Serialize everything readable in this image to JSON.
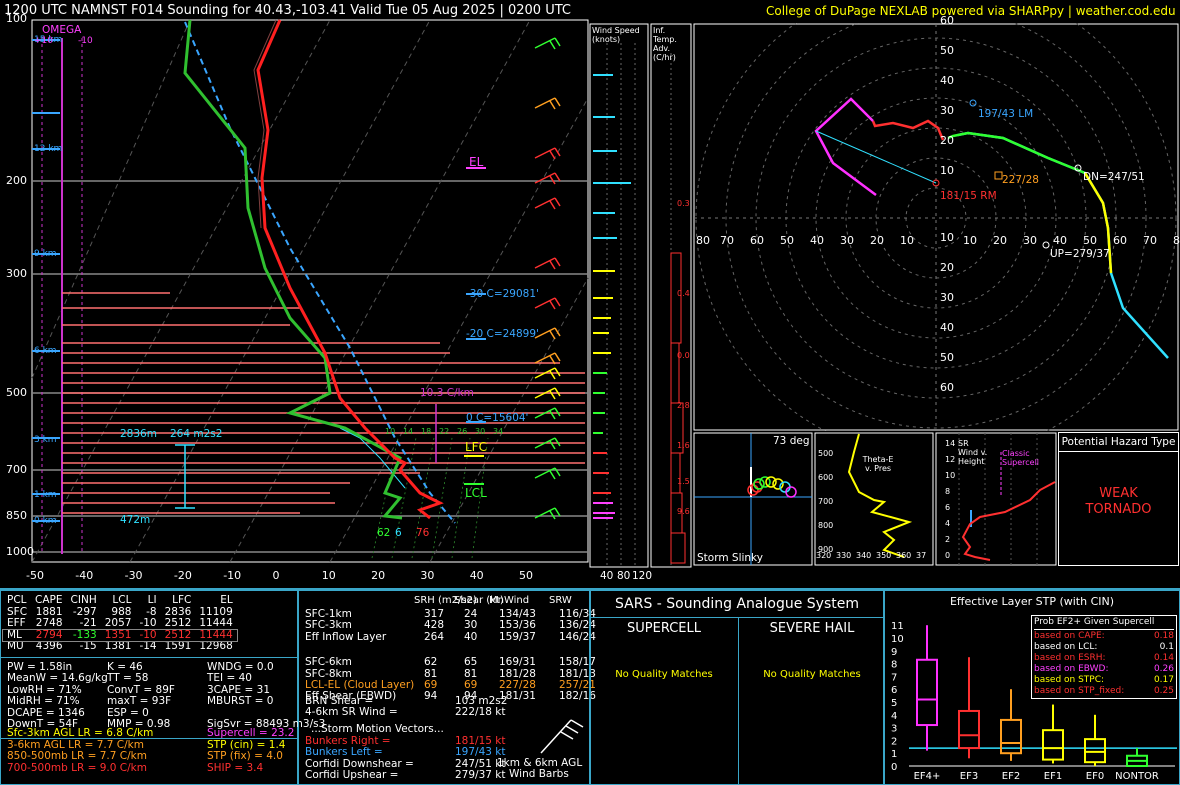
{
  "header": {
    "title": "1200 UTC NAMNST F014 Sounding for 40.43,-103.41 Valid  Tue 05 Aug 2025 | 0200 UTC",
    "credit": "College of DuPage NEXLAB powered via SHARPpy | weather.cod.edu"
  },
  "skewt": {
    "pressure_ticks": [
      "100",
      "200",
      "300",
      "500",
      "700",
      "850",
      "1000"
    ],
    "temp_ticks": [
      "-50",
      "-40",
      "-30",
      "-20",
      "-10",
      "0",
      "10",
      "20",
      "30",
      "40",
      "50"
    ],
    "height_labels": [
      "15 km",
      "12 km",
      "9 km",
      "6 km",
      "3 km",
      "1 km",
      "0 km"
    ],
    "omega_label": "OMEGA",
    "omega_scale": [
      "+10",
      "-10"
    ],
    "labels": {
      "el": "EL",
      "lfc": "LFC",
      "lcl": "LCL",
      "m30": "-30 C=29081'",
      "m20": "-20 C=24899'",
      "zero": "0 C=15604'",
      "lapse": "10.3 C/km",
      "depth": "2836m",
      "srh": "264 m2s2",
      "sfc_depth": "472m",
      "sfc_td": "62",
      "sfc_wb": "6",
      "sfc_t": "76"
    },
    "mix_ratio_labels": [
      "10",
      "14",
      "18",
      "22",
      "26",
      "30",
      "34"
    ]
  },
  "wind_speed": {
    "title": "Wind Speed (knots)",
    "ticks": [
      "40",
      "80",
      "120"
    ]
  },
  "temp_adv": {
    "title": "Inf. Temp. Adv. (C/hr)",
    "values": [
      "0.3",
      "0.4",
      "0.0",
      "2.8",
      "1.6",
      "1.5",
      "9.6"
    ]
  },
  "hodograph": {
    "rings": [
      "10",
      "20",
      "30",
      "40",
      "50",
      "60"
    ],
    "x_ticks": [
      "80",
      "70",
      "60",
      "50",
      "40",
      "30",
      "20",
      "10",
      "10",
      "20",
      "30",
      "40",
      "50",
      "60",
      "70",
      "80"
    ],
    "lm": "197/43 LM",
    "rm": "181/15 RM",
    "mean": "227/28",
    "dn": "DN=247/51",
    "up": "UP=279/37"
  },
  "slinky": {
    "deg": "73 deg",
    "title": "Storm Slinky"
  },
  "theta": {
    "title": "Theta-E v. Pres",
    "y_ticks": [
      "500",
      "600",
      "700",
      "800",
      "900"
    ],
    "x_ticks": [
      "320",
      "330",
      "340",
      "350",
      "360",
      "37"
    ]
  },
  "srwind": {
    "title": "SR Wind v. Height",
    "y_ticks": [
      "14",
      "12",
      "10",
      "8",
      "6",
      "4",
      "2",
      "0"
    ],
    "classic": "Classic Supercell"
  },
  "hazard": {
    "title": "Potential Hazard Type",
    "value_line1": "WEAK",
    "value_line2": "TORNADO"
  },
  "parcels": {
    "headers": [
      "PCL",
      "CAPE",
      "CINH",
      "LCL",
      "LI",
      "LFC",
      "EL"
    ],
    "rows": [
      [
        "SFC",
        "1881",
        "-297",
        "988",
        "-8",
        "2836",
        "11109"
      ],
      [
        "EFF",
        "2748",
        "-21",
        "2057",
        "-10",
        "2512",
        "11444"
      ],
      [
        "ML",
        "2794",
        "-133",
        "1351",
        "-10",
        "2512",
        "11444"
      ],
      [
        "MU",
        "4396",
        "-15",
        "1381",
        "-14",
        "1591",
        "12968"
      ]
    ]
  },
  "indices": [
    [
      "PW = 1.58in",
      "K = 46",
      "WNDG = 0.0"
    ],
    [
      "MeanW = 14.6g/kg",
      "TT = 58",
      "TEI = 40"
    ],
    [
      "LowRH = 71%",
      "ConvT = 89F",
      "3CAPE = 31"
    ],
    [
      "MidRH = 71%",
      "maxT = 93F",
      "MBURST = 0"
    ],
    [
      "DCAPE = 1346",
      "ESP = 0",
      ""
    ],
    [
      "DownT = 54F",
      "MMP = 0.98",
      "SigSvr = 88493 m3/s3"
    ]
  ],
  "lapse": [
    {
      "text": "Sfc-3km AGL LR = 6.8 C/km",
      "color": "#ffff00"
    },
    {
      "text": "3-6km AGL LR = 7.7 C/km",
      "color": "#ff9f20"
    },
    {
      "text": "850-500mb LR = 7.7 C/km",
      "color": "#ff9f20"
    },
    {
      "text": "700-500mb LR = 9.0 C/km",
      "color": "#ff3030"
    }
  ],
  "composite": [
    {
      "text": "Supercell = 23.2",
      "color": "#ff40ff"
    },
    {
      "text": "STP (cin) = 1.4",
      "color": "#ffff00"
    },
    {
      "text": "STP (fix) = 4.0",
      "color": "#ff9f20"
    },
    {
      "text": "SHIP = 3.4",
      "color": "#ff3030"
    }
  ],
  "kinematics": {
    "headers": [
      "",
      "SRH (m2/s2)",
      "Shear (kt)",
      "MnWind",
      "SRW"
    ],
    "rows": [
      [
        "SFC-1km",
        "317",
        "24",
        "134/43",
        "116/34"
      ],
      [
        "SFC-3km",
        "428",
        "30",
        "153/36",
        "136/24"
      ],
      [
        "Eff Inflow Layer",
        "264",
        "40",
        "159/37",
        "146/24"
      ],
      [
        "",
        "",
        "",
        "",
        ""
      ],
      [
        "SFC-6km",
        "62",
        "65",
        "169/31",
        "158/17"
      ],
      [
        "SFC-8km",
        "81",
        "81",
        "181/28",
        "181/13"
      ],
      [
        "LCL-EL (Cloud Layer)",
        "69",
        "69",
        "227/28",
        "257/21"
      ],
      [
        "Eff Shear (EBWD)",
        "94",
        "94",
        "181/31",
        "182/16"
      ]
    ],
    "brn": "BRN Shear =",
    "brn_val": "103 m2s2",
    "sr46": "4-6km SR Wind =",
    "sr46_val": "222/18 kt",
    "motion_title": "...Storm Motion Vectors...",
    "motions": [
      {
        "k": "Bunkers Right =",
        "v": "181/15 kt",
        "color": "#ff3030"
      },
      {
        "k": "Bunkers Left =",
        "v": "197/43 kt",
        "color": "#3aa6ff"
      },
      {
        "k": "Corfidi Downshear =",
        "v": "247/51 kt",
        "color": "#ffffff"
      },
      {
        "k": "Corfidi Upshear =",
        "v": "279/37 kt",
        "color": "#ffffff"
      }
    ],
    "barb_label1": "1km & 6km AGL",
    "barb_label2": "Wind Barbs"
  },
  "sars": {
    "title": "SARS - Sounding Analogue System",
    "supercell": "SUPERCELL",
    "hail": "SEVERE HAIL",
    "nomatch1": "No Quality Matches",
    "nomatch2": "No Quality Matches"
  },
  "stp": {
    "title": "Effective Layer STP (with CIN)",
    "y_ticks": [
      "11",
      "10",
      "9",
      "8",
      "7",
      "6",
      "5",
      "4",
      "3",
      "2",
      "1",
      "0"
    ],
    "categories": [
      "EF4+",
      "EF3",
      "EF2",
      "EF1",
      "EF0",
      "NONTOR"
    ],
    "legend_title": "Prob EF2+ Given Supercell",
    "legend": [
      {
        "k": "based on CAPE:",
        "v": "0.18",
        "color": "#ff3030"
      },
      {
        "k": "based on LCL:",
        "v": "0.1",
        "color": "#ffffff"
      },
      {
        "k": "based on ESRH:",
        "v": "0.14",
        "color": "#ff3030"
      },
      {
        "k": "based on EBWD:",
        "v": "0.26",
        "color": "#ff40ff"
      },
      {
        "k": "based on STPC:",
        "v": "0.17",
        "color": "#ffff00"
      },
      {
        "k": "based on STP_fixed:",
        "v": "0.25",
        "color": "#ff3030"
      }
    ]
  },
  "chart_data": {
    "type": "line",
    "title": "1200 UTC NAMNST F014 Sounding for 40.43,-103.41",
    "stp_boxes": [
      {
        "name": "EF4+",
        "min": 1.2,
        "q1": 3.2,
        "med": 5.2,
        "q3": 8.3,
        "max": 11.0,
        "color": "#ff30ff"
      },
      {
        "name": "EF3",
        "min": 0.6,
        "q1": 1.4,
        "med": 2.4,
        "q3": 4.3,
        "max": 8.5,
        "color": "#ff3030"
      },
      {
        "name": "EF2",
        "min": 0.4,
        "q1": 1.0,
        "med": 1.8,
        "q3": 3.6,
        "max": 6.0,
        "color": "#ff9f20"
      },
      {
        "name": "EF1",
        "min": 0.2,
        "q1": 0.5,
        "med": 1.4,
        "q3": 2.8,
        "max": 4.8,
        "color": "#ffff00"
      },
      {
        "name": "EF0",
        "min": 0.0,
        "q1": 0.3,
        "med": 1.1,
        "q3": 2.1,
        "max": 4.0,
        "color": "#ffff00"
      },
      {
        "name": "NONTOR",
        "min": 0.0,
        "q1": 0.0,
        "med": 0.4,
        "q3": 0.8,
        "max": 1.4,
        "color": "#30ff30"
      }
    ],
    "stp_value": 1.4
  }
}
